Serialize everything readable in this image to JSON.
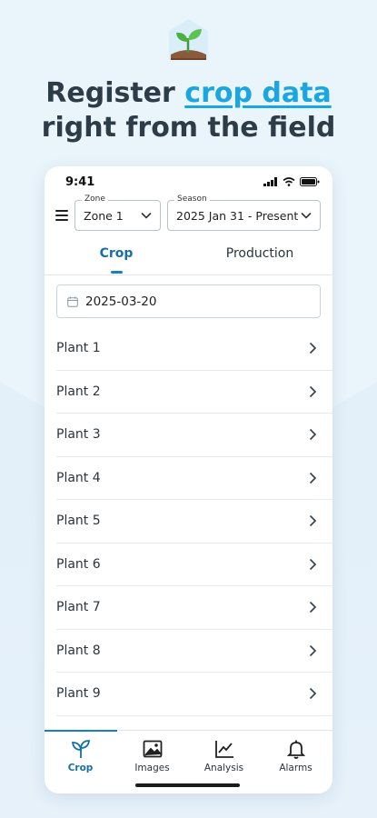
{
  "headline": {
    "line1_prefix": "Register ",
    "line1_accent": "crop data",
    "line2": "right from the field"
  },
  "status_bar": {
    "time": "9:41"
  },
  "filters": {
    "zone": {
      "legend": "Zone",
      "value": "Zone 1"
    },
    "season": {
      "legend": "Season",
      "value": "2025 Jan 31 - Present"
    }
  },
  "tabs": [
    {
      "label": "Crop",
      "active": true
    },
    {
      "label": "Production",
      "active": false
    }
  ],
  "date_field": {
    "value": "2025-03-20"
  },
  "plants": [
    "Plant 1",
    "Plant 2",
    "Plant 3",
    "Plant 4",
    "Plant 5",
    "Plant 6",
    "Plant 7",
    "Plant 8",
    "Plant 9"
  ],
  "bottom_nav": [
    {
      "label": "Crop",
      "icon": "sprout-icon",
      "active": true
    },
    {
      "label": "Images",
      "icon": "image-icon",
      "active": false
    },
    {
      "label": "Analysis",
      "icon": "chart-icon",
      "active": false
    },
    {
      "label": "Alarms",
      "icon": "bell-icon",
      "active": false
    }
  ],
  "colors": {
    "accent": "#1aa6e0",
    "tab_active": "#1670a6",
    "background": "#eaf4fb",
    "headline": "#2e3c48"
  }
}
